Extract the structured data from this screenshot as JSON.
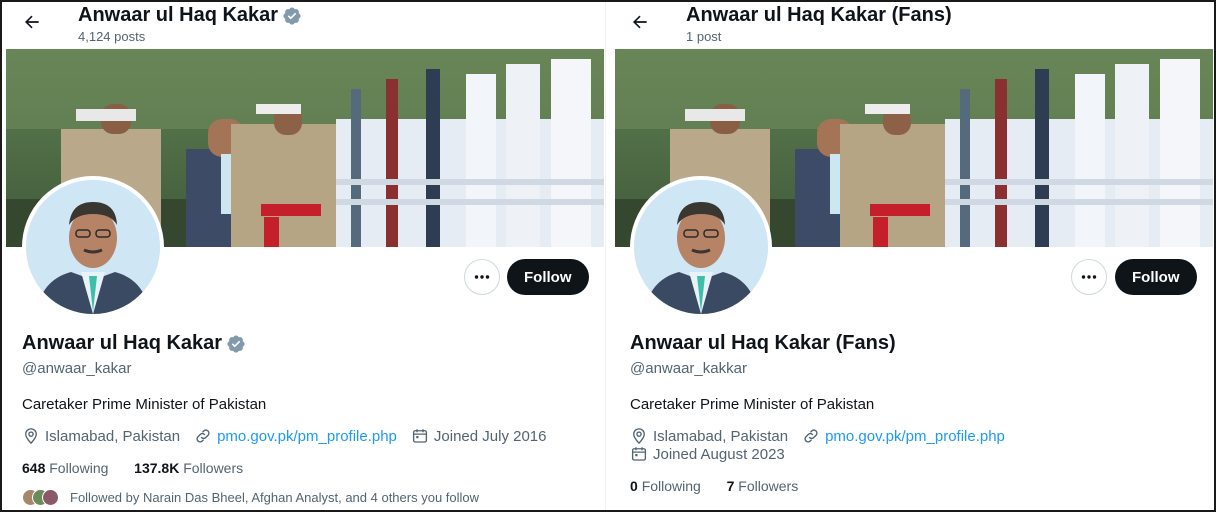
{
  "left": {
    "header": {
      "title": "Anwaar ul Haq Kakar",
      "posts": "4,124 posts"
    },
    "profile": {
      "name": "Anwaar ul Haq Kakar",
      "handle": "@anwaar_kakar",
      "bio": "Caretaker Prime Minister of Pakistan",
      "location": "Islamabad, Pakistan",
      "website": "pmo.gov.pk/pm_profile.php",
      "joined": "Joined July 2016",
      "following_count": "648",
      "following_label": "Following",
      "followers_count": "137.8K",
      "followers_label": "Followers",
      "followed_by": "Followed by Narain Das Bheel, Afghan Analyst, and 4 others you follow"
    },
    "actions": {
      "more_label": "···",
      "follow_label": "Follow"
    },
    "icons": {
      "back": "arrow-left-icon",
      "verified": "verified-badge-icon"
    }
  },
  "right": {
    "header": {
      "title": "Anwaar ul Haq Kakar (Fans)",
      "posts": "1 post"
    },
    "profile": {
      "name": "Anwaar ul Haq Kakar (Fans)",
      "handle": "@anwaar_kakkar",
      "bio": "Caretaker Prime Minister of Pakistan",
      "location": "Islamabad, Pakistan",
      "website": "pmo.gov.pk/pm_profile.php",
      "joined": "Joined August 2023",
      "following_count": "0",
      "following_label": "Following",
      "followers_count": "7",
      "followers_label": "Followers"
    },
    "actions": {
      "more_label": "···",
      "follow_label": "Follow"
    }
  },
  "colors": {
    "accent": "#1d9bf0",
    "text": "#0f1419",
    "muted": "#536471",
    "verified": "#829aab",
    "button": "#0f1419"
  }
}
